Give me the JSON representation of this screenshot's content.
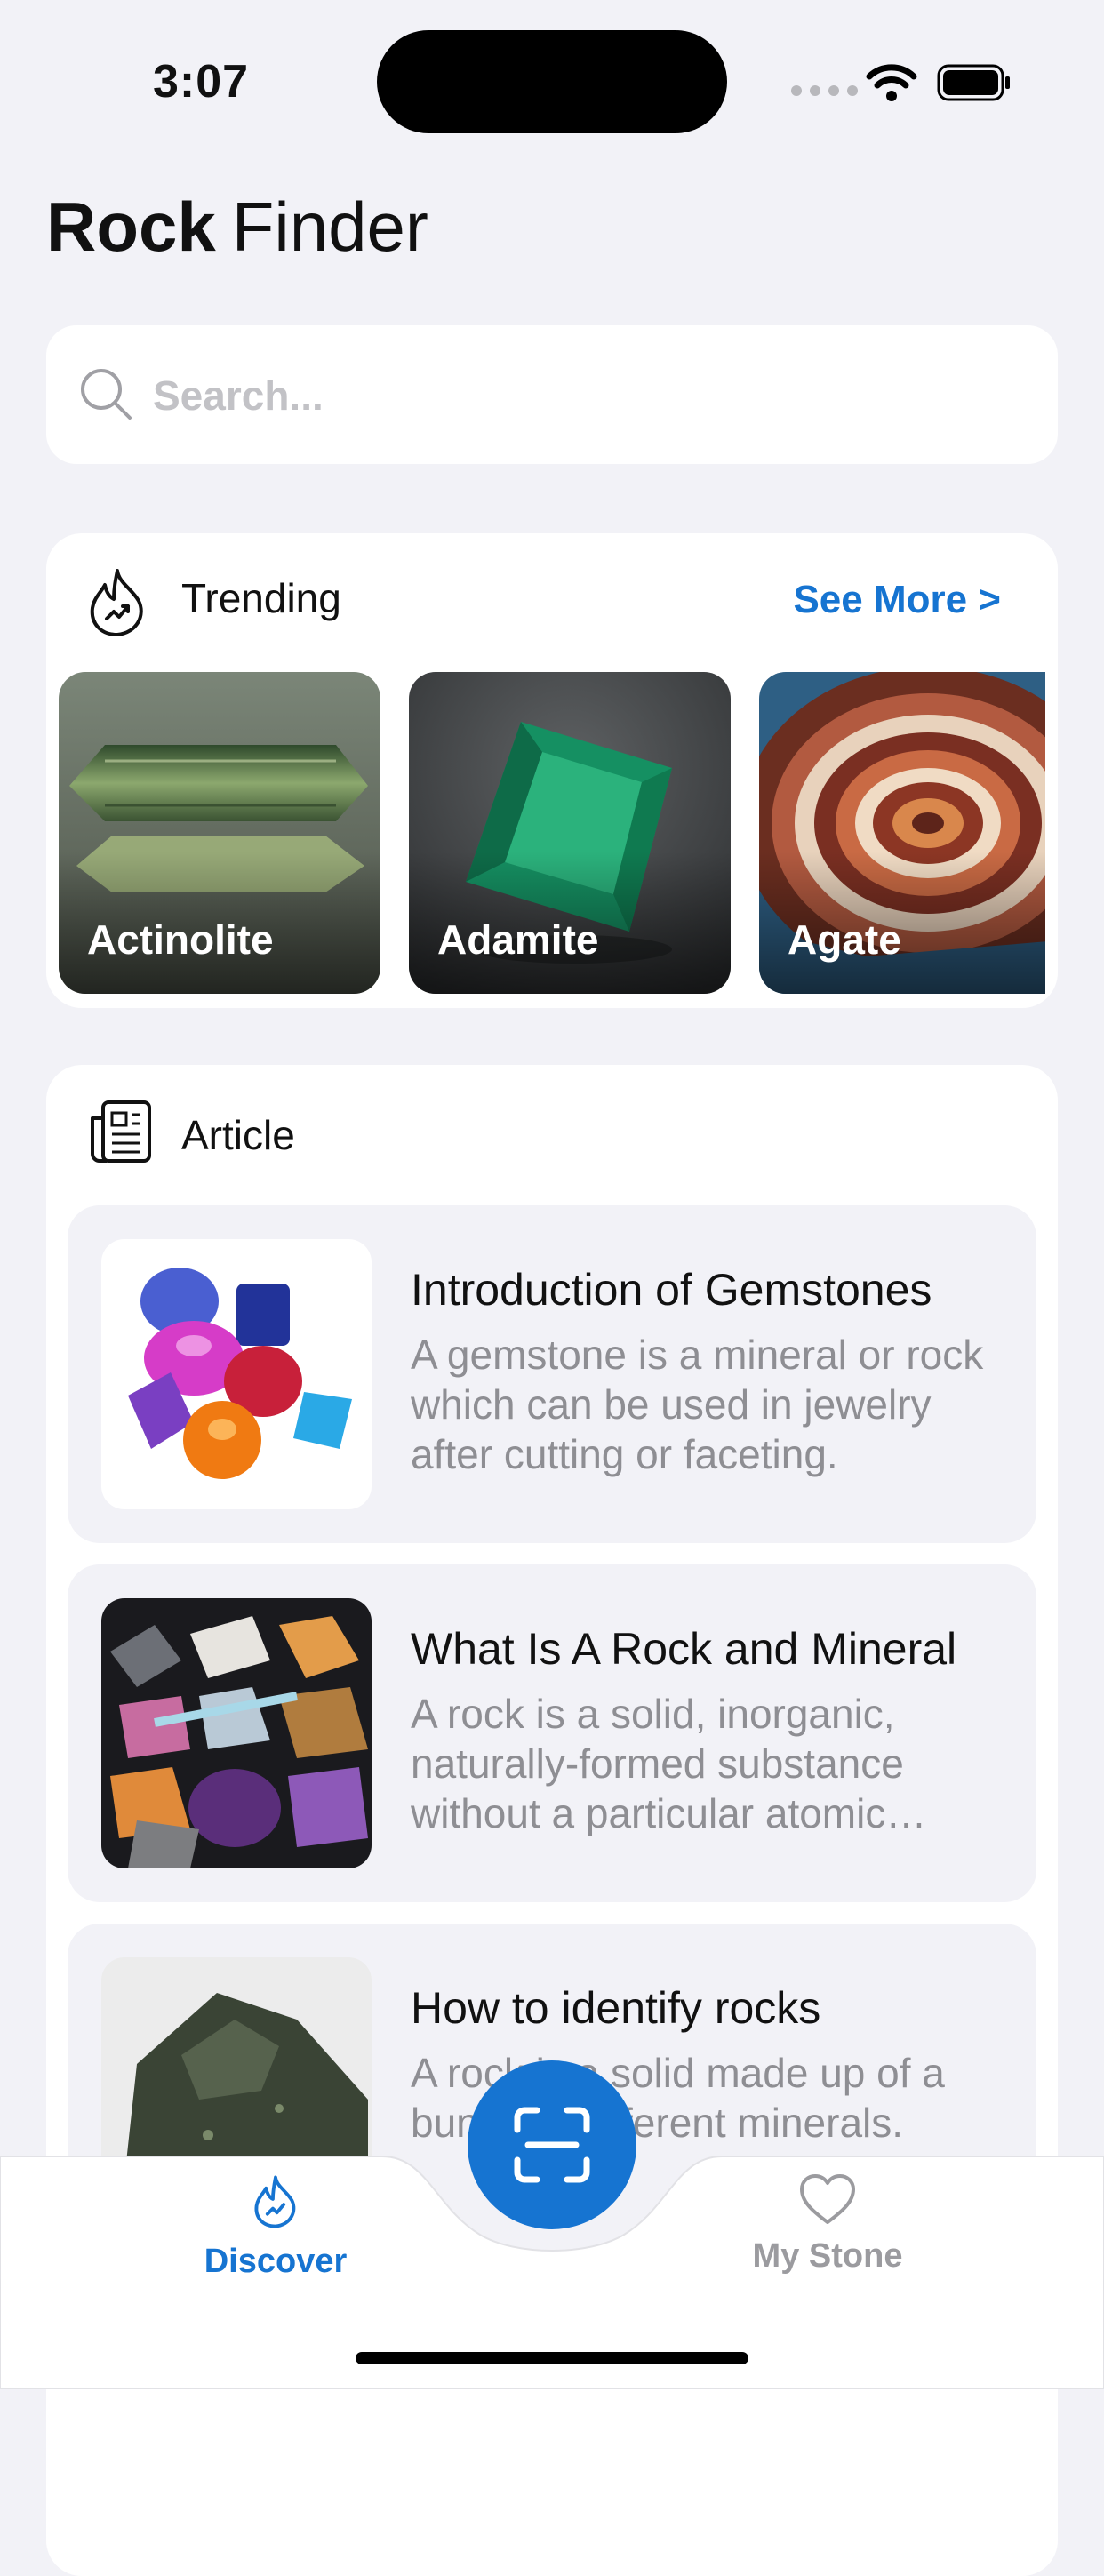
{
  "status_bar": {
    "time": "3:07"
  },
  "header": {
    "title_bold": "Rock",
    "title_light": "Finder"
  },
  "search": {
    "placeholder": "Search..."
  },
  "trending": {
    "title": "Trending",
    "see_more": "See More >",
    "items": [
      {
        "name": "Actinolite"
      },
      {
        "name": "Adamite"
      },
      {
        "name": "Agate"
      }
    ]
  },
  "articles": {
    "title": "Article",
    "items": [
      {
        "title": "Introduction of Gemstones",
        "summary": "A gemstone is a mineral or rock which can be used in jewelry after cutting or faceting."
      },
      {
        "title": "What Is A Rock and Mineral",
        "summary": "A rock is a solid, inorganic, naturally-formed substance without a particular atomic structure."
      },
      {
        "title": "How to identify rocks",
        "summary": "A rock is a solid made up of a bunch of different minerals."
      }
    ]
  },
  "tab_bar": {
    "tabs": [
      {
        "label": "Discover",
        "icon": "flame-icon",
        "active": true
      },
      {
        "label": "My Stone",
        "icon": "heart-icon",
        "active": false
      }
    ],
    "scan_icon": "scan-icon",
    "accent_color": "#1674d1"
  }
}
